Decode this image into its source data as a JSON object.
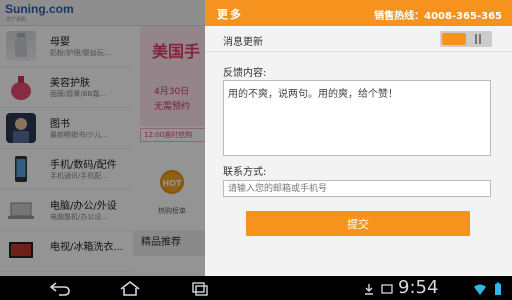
{
  "app": {
    "logo": "Suning.com",
    "logo_sub": "苏宁易购"
  },
  "categories": [
    {
      "title": "母婴",
      "sub": "奶粉/护理/婴幼玩..."
    },
    {
      "title": "美容护肤",
      "sub": "面膜/唇膏/BB霜..."
    },
    {
      "title": "图书",
      "sub": "最新畅销书/少儿..."
    },
    {
      "title": "手机/数码/配件",
      "sub": "手机通讯/手机配..."
    },
    {
      "title": "电脑/办公/外设",
      "sub": "电脑整机/办公设..."
    },
    {
      "title": "电视/冰箱洗衣...",
      "sub": ""
    }
  ],
  "banner": {
    "title": "美国手",
    "date": "4月30日",
    "note": "无需预约",
    "time": "12:00准时抢购"
  },
  "rank": {
    "badge": "HOT",
    "label": "热购榜单"
  },
  "recommend": "精品推荐",
  "panel": {
    "title": "更多",
    "hotline": "销售热线：4008-365-365",
    "update_label": "消息更新",
    "feedback_label": "反馈内容:",
    "feedback_value": "用的不爽，说两句。用的爽，给个赞！",
    "contact_label": "联系方式:",
    "contact_placeholder": "请输入您的邮箱或手机号",
    "submit_label": "提交"
  },
  "statusbar": {
    "time": "9:54"
  },
  "colors": {
    "accent": "#f5931e",
    "logo_blue": "#2a5fb0",
    "banner_pink": "#e63e6d"
  }
}
